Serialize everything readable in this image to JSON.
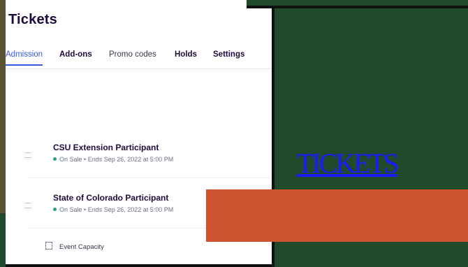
{
  "header": {
    "title": "Tickets"
  },
  "tabs": [
    {
      "label": "Admission",
      "active": true
    },
    {
      "label": "Add-ons",
      "active": false
    },
    {
      "label": "Promo codes",
      "active": false
    },
    {
      "label": "Holds",
      "active": false
    },
    {
      "label": "Settings",
      "active": false
    }
  ],
  "tickets": [
    {
      "name": "CSU Extension Participant",
      "status": "On Sale",
      "ends": "Ends Sep 26, 2022 at 5:00 PM"
    },
    {
      "name": "State of Colorado Participant",
      "status": "On Sale",
      "ends": "Ends Sep 26, 2022 at 5:00 PM"
    }
  ],
  "capacity": {
    "label": "Event Capacity",
    "icon": "capacity-icon"
  },
  "overlay": {
    "link_text": "TICKETS"
  },
  "colors": {
    "accent": "#3659e3",
    "on_sale": "#2ea26a",
    "background": "#1f4a2c",
    "orange": "#cc5530",
    "link": "#1a1aff"
  }
}
